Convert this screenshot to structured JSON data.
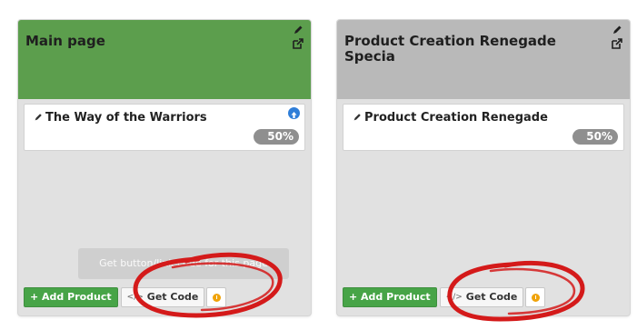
{
  "cards": [
    {
      "title": "Main page",
      "header_color": "#5c9e4d",
      "product": {
        "name": "The Way of the Warriors",
        "progress_label": "50%",
        "progress": 0.5
      },
      "tooltip": "Get button/link code for this page",
      "add_label": "+ Add Product",
      "code_label": "Get Code",
      "code_icon": "</>"
    },
    {
      "title": "Product Creation Renegade Specia",
      "header_color": "#b9b9b9",
      "product": {
        "name": "Product Creation Renegade",
        "progress_label": "50%",
        "progress": 0.5
      },
      "add_label": "+ Add Product",
      "code_label": "Get Code",
      "code_icon": "</>"
    }
  ],
  "colors": {
    "annotation": "#d41a1a",
    "add_button": "#47a447",
    "warning": "#f0a30a",
    "info": "#2f7ed8",
    "card_background": "#e1e1e1"
  },
  "icons": [
    "pencil-icon",
    "external-link-icon",
    "info-icon",
    "code-icon",
    "warning-icon"
  ]
}
